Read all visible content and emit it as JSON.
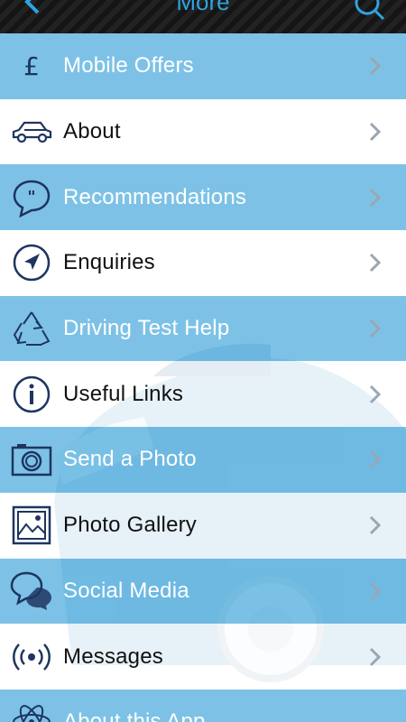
{
  "header": {
    "title": "More",
    "back_icon": "back-arrow-icon",
    "search_icon": "search-icon",
    "accent": "#2fa3e0"
  },
  "menu": {
    "items": [
      {
        "label": "Mobile Offers",
        "icon": "pound-icon",
        "style": "blue"
      },
      {
        "label": "About",
        "icon": "car-icon",
        "style": "white"
      },
      {
        "label": "Recommendations",
        "icon": "quote-bubble-icon",
        "style": "blue"
      },
      {
        "label": "Enquiries",
        "icon": "navigation-arrow-icon",
        "style": "white"
      },
      {
        "label": "Driving Test Help",
        "icon": "recycle-icon",
        "style": "blue"
      },
      {
        "label": "Useful Links",
        "icon": "info-icon",
        "style": "white"
      },
      {
        "label": "Send a Photo",
        "icon": "camera-icon",
        "style": "blue"
      },
      {
        "label": "Photo Gallery",
        "icon": "picture-icon",
        "style": "white"
      },
      {
        "label": "Social Media",
        "icon": "chat-bubbles-icon",
        "style": "blue"
      },
      {
        "label": "Messages",
        "icon": "broadcast-icon",
        "style": "white"
      },
      {
        "label": "About this App",
        "icon": "atom-icon",
        "style": "blue"
      }
    ]
  },
  "colors": {
    "blue_row": "#68b8e2",
    "icon_navy": "#1e3560"
  }
}
